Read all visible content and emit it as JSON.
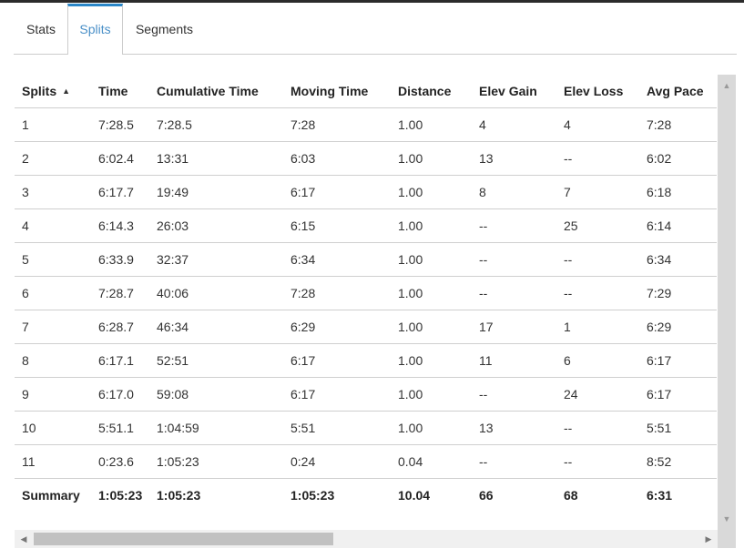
{
  "tabs": [
    {
      "label": "Stats",
      "active": false
    },
    {
      "label": "Splits",
      "active": true
    },
    {
      "label": "Segments",
      "active": false
    }
  ],
  "table": {
    "columns": [
      "Splits",
      "Time",
      "Cumulative Time",
      "Moving Time",
      "Distance",
      "Elev Gain",
      "Elev Loss",
      "Avg Pace"
    ],
    "sort_column": "Splits",
    "sort_direction": "ascending",
    "rows": [
      [
        "1",
        "7:28.5",
        "7:28.5",
        "7:28",
        "1.00",
        "4",
        "4",
        "7:28"
      ],
      [
        "2",
        "6:02.4",
        "13:31",
        "6:03",
        "1.00",
        "13",
        "--",
        "6:02"
      ],
      [
        "3",
        "6:17.7",
        "19:49",
        "6:17",
        "1.00",
        "8",
        "7",
        "6:18"
      ],
      [
        "4",
        "6:14.3",
        "26:03",
        "6:15",
        "1.00",
        "--",
        "25",
        "6:14"
      ],
      [
        "5",
        "6:33.9",
        "32:37",
        "6:34",
        "1.00",
        "--",
        "--",
        "6:34"
      ],
      [
        "6",
        "7:28.7",
        "40:06",
        "7:28",
        "1.00",
        "--",
        "--",
        "7:29"
      ],
      [
        "7",
        "6:28.7",
        "46:34",
        "6:29",
        "1.00",
        "17",
        "1",
        "6:29"
      ],
      [
        "8",
        "6:17.1",
        "52:51",
        "6:17",
        "1.00",
        "11",
        "6",
        "6:17"
      ],
      [
        "9",
        "6:17.0",
        "59:08",
        "6:17",
        "1.00",
        "--",
        "24",
        "6:17"
      ],
      [
        "10",
        "5:51.1",
        "1:04:59",
        "5:51",
        "1.00",
        "13",
        "--",
        "5:51"
      ],
      [
        "11",
        "0:23.6",
        "1:05:23",
        "0:24",
        "0.04",
        "--",
        "--",
        "8:52"
      ]
    ],
    "summary": [
      "Summary",
      "1:05:23",
      "1:05:23",
      "1:05:23",
      "10.04",
      "66",
      "68",
      "6:31"
    ]
  },
  "icons": {
    "sort": "▲",
    "scroll_up": "▲",
    "scroll_down": "▼",
    "scroll_left": "◀",
    "scroll_right": "▶"
  },
  "colors": {
    "active_tab_text": "#4a90c8",
    "active_tab_border": "#2a87c9",
    "row_divider": "#cfcfcf",
    "scrollbar_track": "#d9d9d9",
    "scrollbar_thumb": "#c1c1c1"
  }
}
